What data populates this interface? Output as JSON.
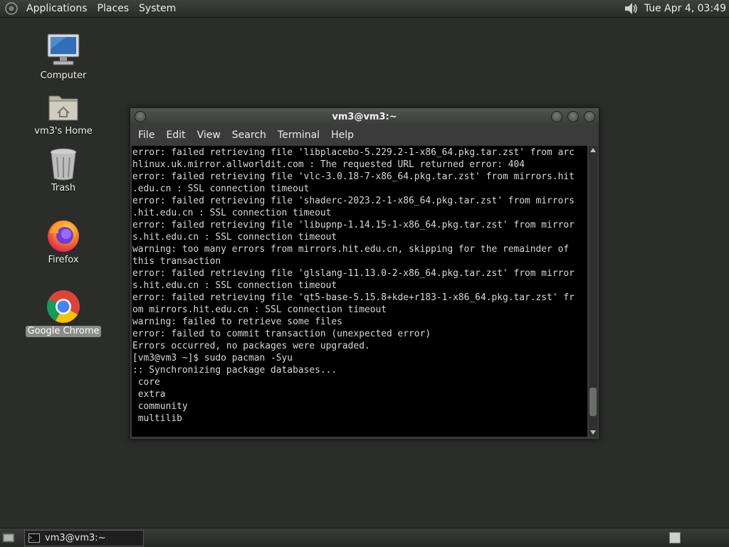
{
  "top_panel": {
    "menus": [
      "Applications",
      "Places",
      "System"
    ],
    "clock": "Tue Apr  4, 03:49"
  },
  "desktop_icons": [
    {
      "label": "Computer",
      "icon": "computer-icon"
    },
    {
      "label": "vm3's Home",
      "icon": "home-folder-icon"
    },
    {
      "label": "Trash",
      "icon": "trash-icon"
    },
    {
      "label": "Firefox",
      "icon": "firefox-icon"
    },
    {
      "label": "Google Chrome",
      "icon": "chrome-icon",
      "selected": true
    }
  ],
  "terminal": {
    "title": "vm3@vm3:~",
    "menus": [
      "File",
      "Edit",
      "View",
      "Search",
      "Terminal",
      "Help"
    ],
    "lines": [
      "error: failed retrieving file 'libplacebo-5.229.2-1-x86_64.pkg.tar.zst' from arc",
      "hlinux.uk.mirror.allworldit.com : The requested URL returned error: 404",
      "error: failed retrieving file 'vlc-3.0.18-7-x86_64.pkg.tar.zst' from mirrors.hit",
      ".edu.cn : SSL connection timeout",
      "error: failed retrieving file 'shaderc-2023.2-1-x86_64.pkg.tar.zst' from mirrors",
      ".hit.edu.cn : SSL connection timeout",
      "error: failed retrieving file 'libupnp-1.14.15-1-x86_64.pkg.tar.zst' from mirror",
      "s.hit.edu.cn : SSL connection timeout",
      "warning: too many errors from mirrors.hit.edu.cn, skipping for the remainder of",
      "this transaction",
      "error: failed retrieving file 'glslang-11.13.0-2-x86_64.pkg.tar.zst' from mirror",
      "s.hit.edu.cn : SSL connection timeout",
      "error: failed retrieving file 'qt5-base-5.15.8+kde+r183-1-x86_64.pkg.tar.zst' fr",
      "om mirrors.hit.edu.cn : SSL connection timeout",
      "warning: failed to retrieve some files",
      "error: failed to commit transaction (unexpected error)",
      "Errors occurred, no packages were upgraded.",
      "[vm3@vm3 ~]$ sudo pacman -Syu",
      ":: Synchronizing package databases...",
      " core",
      " extra",
      " community",
      " multilib"
    ],
    "scroll_position": 0.95
  },
  "taskbar": {
    "task_label": "vm3@vm3:~"
  }
}
